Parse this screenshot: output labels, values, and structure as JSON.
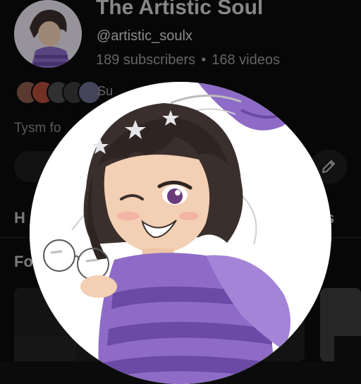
{
  "channel": {
    "name": "The Artistic Soul",
    "handle": "@artistic_soulx",
    "subscribers": "189 subscribers",
    "separator": "•",
    "videos": "168 videos"
  },
  "peek_text": {
    "subscribed_by": "Su",
    "description": "Tysm fo",
    "tab_left": "H",
    "tab_right": "s",
    "section": "Fo"
  },
  "icons": {
    "edit": "pencil-icon"
  },
  "colors": {
    "background": "#0b0b0b",
    "avatar_bg": "#ffffff",
    "sweater_purple": "#8d6bc6",
    "sweater_stripe": "#6a4aa6",
    "hair": "#3a2f2c",
    "eye": "#6b3c7c"
  }
}
